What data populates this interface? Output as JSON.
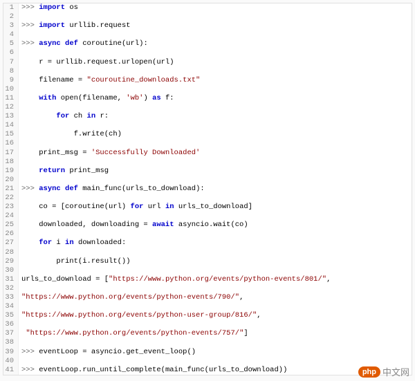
{
  "logo": {
    "badge": "php",
    "text": "中文网"
  },
  "lines": [
    {
      "n": 1,
      "segs": [
        {
          "t": "prompt",
          "v": ">>> "
        },
        {
          "t": "kw",
          "v": "import"
        },
        {
          "t": "fn",
          "v": " os"
        }
      ]
    },
    {
      "n": 2,
      "segs": []
    },
    {
      "n": 3,
      "segs": [
        {
          "t": "prompt",
          "v": ">>> "
        },
        {
          "t": "kw",
          "v": "import"
        },
        {
          "t": "fn",
          "v": " urllib.request"
        }
      ]
    },
    {
      "n": 4,
      "segs": []
    },
    {
      "n": 5,
      "segs": [
        {
          "t": "prompt",
          "v": ">>> "
        },
        {
          "t": "kw",
          "v": "async def"
        },
        {
          "t": "fn",
          "v": " coroutine(url):"
        }
      ]
    },
    {
      "n": 6,
      "segs": []
    },
    {
      "n": 7,
      "segs": [
        {
          "t": "fn",
          "v": "    r = urllib.request.urlopen(url)"
        }
      ]
    },
    {
      "n": 8,
      "segs": []
    },
    {
      "n": 9,
      "segs": [
        {
          "t": "fn",
          "v": "    filename = "
        },
        {
          "t": "str",
          "v": "\"couroutine_downloads.txt\""
        }
      ]
    },
    {
      "n": 10,
      "segs": []
    },
    {
      "n": 11,
      "segs": [
        {
          "t": "fn",
          "v": "    "
        },
        {
          "t": "kw",
          "v": "with"
        },
        {
          "t": "fn",
          "v": " open(filename, "
        },
        {
          "t": "str",
          "v": "'wb'"
        },
        {
          "t": "fn",
          "v": ") "
        },
        {
          "t": "kw",
          "v": "as"
        },
        {
          "t": "fn",
          "v": " f:"
        }
      ]
    },
    {
      "n": 12,
      "segs": []
    },
    {
      "n": 13,
      "segs": [
        {
          "t": "fn",
          "v": "        "
        },
        {
          "t": "kw",
          "v": "for"
        },
        {
          "t": "fn",
          "v": " ch "
        },
        {
          "t": "kw",
          "v": "in"
        },
        {
          "t": "fn",
          "v": " r:"
        }
      ]
    },
    {
      "n": 14,
      "segs": []
    },
    {
      "n": 15,
      "segs": [
        {
          "t": "fn",
          "v": "            f.write(ch)"
        }
      ]
    },
    {
      "n": 16,
      "segs": []
    },
    {
      "n": 17,
      "segs": [
        {
          "t": "fn",
          "v": "    print_msg = "
        },
        {
          "t": "str",
          "v": "'Successfully Downloaded'"
        }
      ]
    },
    {
      "n": 18,
      "segs": []
    },
    {
      "n": 19,
      "segs": [
        {
          "t": "fn",
          "v": "    "
        },
        {
          "t": "kw",
          "v": "return"
        },
        {
          "t": "fn",
          "v": " print_msg"
        }
      ]
    },
    {
      "n": 20,
      "segs": []
    },
    {
      "n": 21,
      "segs": [
        {
          "t": "prompt",
          "v": ">>> "
        },
        {
          "t": "kw",
          "v": "async def"
        },
        {
          "t": "fn",
          "v": " main_func(urls_to_download):"
        }
      ]
    },
    {
      "n": 22,
      "segs": []
    },
    {
      "n": 23,
      "segs": [
        {
          "t": "fn",
          "v": "    co = [coroutine(url) "
        },
        {
          "t": "kw",
          "v": "for"
        },
        {
          "t": "fn",
          "v": " url "
        },
        {
          "t": "kw",
          "v": "in"
        },
        {
          "t": "fn",
          "v": " urls_to_download]"
        }
      ]
    },
    {
      "n": 24,
      "segs": []
    },
    {
      "n": 25,
      "segs": [
        {
          "t": "fn",
          "v": "    downloaded, downloading = "
        },
        {
          "t": "kw",
          "v": "await"
        },
        {
          "t": "fn",
          "v": " asyncio.wait(co)"
        }
      ]
    },
    {
      "n": 26,
      "segs": []
    },
    {
      "n": 27,
      "segs": [
        {
          "t": "fn",
          "v": "    "
        },
        {
          "t": "kw",
          "v": "for"
        },
        {
          "t": "fn",
          "v": " i "
        },
        {
          "t": "kw",
          "v": "in"
        },
        {
          "t": "fn",
          "v": " downloaded:"
        }
      ]
    },
    {
      "n": 28,
      "segs": []
    },
    {
      "n": 29,
      "segs": [
        {
          "t": "fn",
          "v": "        print(i.result())"
        }
      ]
    },
    {
      "n": 30,
      "segs": []
    },
    {
      "n": 31,
      "segs": [
        {
          "t": "fn",
          "v": "urls_to_download = ["
        },
        {
          "t": "str",
          "v": "\"https://www.python.org/events/python-events/801/\""
        },
        {
          "t": "fn",
          "v": ","
        }
      ]
    },
    {
      "n": 32,
      "segs": []
    },
    {
      "n": 33,
      "segs": [
        {
          "t": "str",
          "v": "\"https://www.python.org/events/python-events/790/\""
        },
        {
          "t": "fn",
          "v": ","
        }
      ]
    },
    {
      "n": 34,
      "segs": []
    },
    {
      "n": 35,
      "segs": [
        {
          "t": "str",
          "v": "\"https://www.python.org/events/python-user-group/816/\""
        },
        {
          "t": "fn",
          "v": ","
        }
      ]
    },
    {
      "n": 36,
      "segs": []
    },
    {
      "n": 37,
      "segs": [
        {
          "t": "fn",
          "v": " "
        },
        {
          "t": "str",
          "v": "\"https://www.python.org/events/python-events/757/\""
        },
        {
          "t": "fn",
          "v": "]"
        }
      ]
    },
    {
      "n": 38,
      "segs": []
    },
    {
      "n": 39,
      "segs": [
        {
          "t": "prompt",
          "v": ">>> "
        },
        {
          "t": "fn",
          "v": "eventLoop = asyncio.get_event_loop()"
        }
      ]
    },
    {
      "n": 40,
      "segs": []
    },
    {
      "n": 41,
      "segs": [
        {
          "t": "prompt",
          "v": ">>> "
        },
        {
          "t": "fn",
          "v": "eventLoop.run_until_complete(main_func(urls_to_download))"
        }
      ]
    }
  ]
}
